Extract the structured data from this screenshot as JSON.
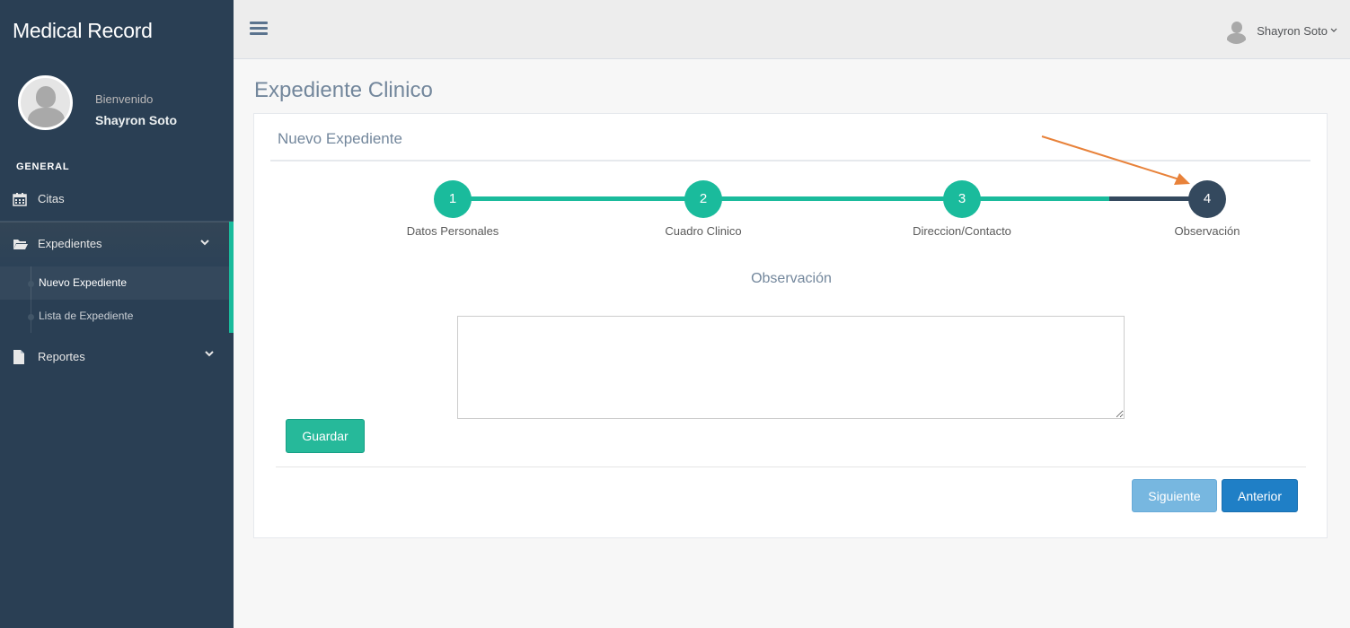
{
  "app": {
    "title": "Medical Record"
  },
  "profile": {
    "welcome": "Bienvenido",
    "name": "Shayron Soto"
  },
  "sidebar": {
    "section": "GENERAL",
    "items": [
      {
        "label": "Citas",
        "icon": "calendar-icon"
      },
      {
        "label": "Expedientes",
        "icon": "folder-open-icon",
        "expanded": true,
        "children": [
          {
            "label": "Nuevo Expediente",
            "current": true
          },
          {
            "label": "Lista de Expediente"
          }
        ]
      },
      {
        "label": "Reportes",
        "icon": "file-icon"
      }
    ]
  },
  "topbar": {
    "user_name": "Shayron Soto"
  },
  "page": {
    "title": "Expediente Clinico"
  },
  "panel": {
    "title": "Nuevo Expediente"
  },
  "wizard": {
    "steps": [
      {
        "number": "1",
        "label": "Datos Personales",
        "state": "done"
      },
      {
        "number": "2",
        "label": "Cuadro Clinico",
        "state": "done"
      },
      {
        "number": "3",
        "label": "Direccion/Contacto",
        "state": "done"
      },
      {
        "number": "4",
        "label": "Observación",
        "state": "current"
      }
    ],
    "colors": {
      "done": "#1abb9c",
      "current": "#34495e"
    }
  },
  "form": {
    "section_label": "Observación",
    "textarea_value": "",
    "save_label": "Guardar"
  },
  "actions": {
    "next_label": "Siguiente",
    "prev_label": "Anterior"
  },
  "colors": {
    "accent": "#1abb9c",
    "sidebar": "#2a3f54",
    "primary": "#1f7fc6",
    "annotation_arrow": "#e8823a"
  }
}
